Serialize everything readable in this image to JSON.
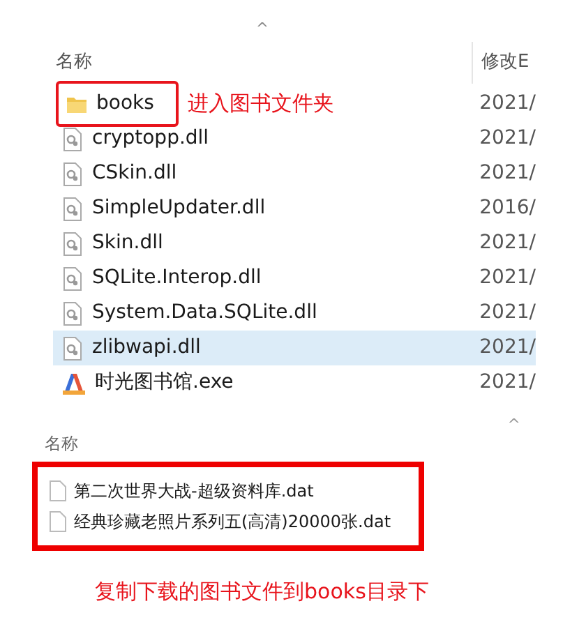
{
  "top_list": {
    "sort_indicator": "^",
    "columns": [
      "名称",
      "修改E"
    ],
    "rows": [
      {
        "kind": "folder",
        "name": "books",
        "date": "2021/",
        "selected": false,
        "highlighted": true,
        "note": "进入图书文件夹"
      },
      {
        "kind": "dll",
        "name": "cryptopp.dll",
        "date": "2021/",
        "selected": false
      },
      {
        "kind": "dll",
        "name": "CSkin.dll",
        "date": "2021/",
        "selected": false
      },
      {
        "kind": "dll",
        "name": "SimpleUpdater.dll",
        "date": "2016/",
        "selected": false
      },
      {
        "kind": "dll",
        "name": "Skin.dll",
        "date": "2021/",
        "selected": false
      },
      {
        "kind": "dll",
        "name": "SQLite.Interop.dll",
        "date": "2021/",
        "selected": false
      },
      {
        "kind": "dll",
        "name": "System.Data.SQLite.dll",
        "date": "2021/",
        "selected": false
      },
      {
        "kind": "dll",
        "name": "zlibwapi.dll",
        "date": "2021/",
        "selected": true
      },
      {
        "kind": "exe",
        "name": "时光图书馆.exe",
        "date": "2021/",
        "selected": false
      }
    ]
  },
  "bottom_list": {
    "sort_indicator": "^",
    "column": "名称",
    "rows": [
      {
        "kind": "dat",
        "name": "第二次世界大战-超级资料库.dat"
      },
      {
        "kind": "dat",
        "name": "经典珍藏老照片系列五(高清)20000张.dat"
      }
    ],
    "caption": "复制下载的图书文件到books目录下"
  }
}
